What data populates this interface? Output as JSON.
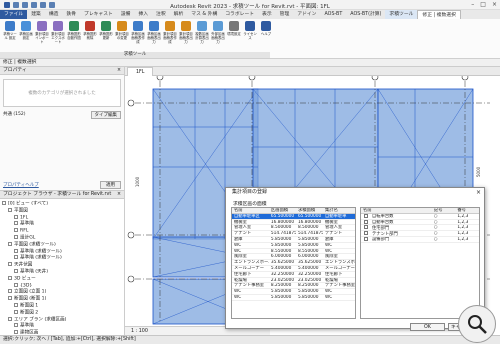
{
  "titlebar": {
    "title": "Autodesk Revit 2023 - 求積ツール for Revit.rvt - 平面図: 1FL"
  },
  "tabs": [
    "ファイル",
    "建築",
    "構造",
    "鉄骨",
    "プレキャスト",
    "設備",
    "挿入",
    "注釈",
    "解析",
    "マス & 外構",
    "コラボレート",
    "表示",
    "管理",
    "アドイン",
    "AOS-BT",
    "AOS-BT(計算)",
    "求積ツール",
    "修正 | 複数選択"
  ],
  "ribbon": {
    "buttons": [
      {
        "label": "求積ツール 設定",
        "color": "#3d7cc9"
      },
      {
        "label": "求積区画 設定",
        "color": "#4a90d9"
      },
      {
        "label": "集計項目 インポート",
        "color": "#8a6fc0"
      },
      {
        "label": "集計項目 エクスポート",
        "color": "#8a6fc0"
      },
      {
        "label": "求積図形 自動作図",
        "color": "#2e8b57"
      },
      {
        "label": "求積図形 削除",
        "color": "#c0392b"
      },
      {
        "label": "求積図形 更新",
        "color": "#2e8b57"
      },
      {
        "label": "集計項目 の変更",
        "color": "#d68a1b"
      },
      {
        "label": "求積区画 面積表作成",
        "color": "#3d7cc9"
      },
      {
        "label": "求積区画 面積表出力",
        "color": "#3d7cc9"
      },
      {
        "label": "集計項目 面積表作成",
        "color": "#d68a1b"
      },
      {
        "label": "集計項目 面積表出力",
        "color": "#d68a1b"
      },
      {
        "label": "複数区画 計算表出力",
        "color": "#5b9bd5"
      },
      {
        "label": "外部区画 面積表出力",
        "color": "#5b9bd5"
      },
      {
        "label": "環境設定",
        "color": "#777777"
      },
      {
        "label": "ライセンス",
        "color": "#2f5aa0"
      },
      {
        "label": "ヘルプ",
        "color": "#2f5aa0"
      }
    ],
    "panel_label": "求積ツール"
  },
  "optionsbar": {
    "text": "修正 | 複数選択"
  },
  "properties": {
    "title": "プロパティ",
    "type_hint": "複数のカテゴリが選択されました",
    "filter_value": "共通 (152)",
    "edit_type": "タイプ編集",
    "help_link": "プロパティヘルプ",
    "apply": "適用"
  },
  "browser": {
    "title": "プロジェクト ブラウザ - 求積ツール for Revit.rvt",
    "tree": [
      {
        "label": "[0] ビュー (すべて)",
        "level": 0
      },
      {
        "label": "平面図",
        "level": 1
      },
      {
        "label": "1FL",
        "level": 2
      },
      {
        "label": "基準階",
        "level": 2
      },
      {
        "label": "RFL",
        "level": 2
      },
      {
        "label": "設計GL",
        "level": 2
      },
      {
        "label": "平面図 (求積ツール)",
        "level": 1
      },
      {
        "label": "基準階 (求積ツール)",
        "level": 2
      },
      {
        "label": "基準階 (求積ツール)",
        "level": 2
      },
      {
        "label": "天井伏図",
        "level": 1
      },
      {
        "label": "基準階 (天井)",
        "level": 2
      },
      {
        "label": "3D ビュー",
        "level": 1
      },
      {
        "label": "{3D}",
        "level": 2
      },
      {
        "label": "立面図 (立面 1)",
        "level": 1
      },
      {
        "label": "断面図 (断面 1)",
        "level": 1
      },
      {
        "label": "断面図 1",
        "level": 2
      },
      {
        "label": "断面図 2",
        "level": 2
      },
      {
        "label": "エリア プラン (求積区画)",
        "level": 1
      },
      {
        "label": "基準階",
        "level": 2
      },
      {
        "label": "建物区画",
        "level": 2
      }
    ]
  },
  "view": {
    "tab_label": "1FL",
    "scale": "1 : 100",
    "dim_left": "1000",
    "dim_top": "5000"
  },
  "status": {
    "text": "選択:クリック; 次へ / [Tab], 追加:+[Ctrl], 選択解除:+[Shift]"
  },
  "dialog": {
    "title": "集計項目の登録",
    "label": "求積区画の面積",
    "left_headers": [
      "名前",
      "区画面積",
      "求積面積",
      "集計名"
    ],
    "left_rows": [
      [
        "自動車駐車区",
        "65.500000",
        "65.500000",
        "自動車駐車"
      ],
      [
        "機械室",
        "16.800000",
        "16.800000",
        "機械室"
      ],
      [
        "管理人室",
        "8.500000",
        "8.500000",
        "管理人室"
      ],
      [
        "テナント",
        "514.741875",
        "514.741875",
        "テナント"
      ],
      [
        "倉庫",
        "5.850000",
        "5.850000",
        "倉庫"
      ],
      [
        "WC",
        "5.850000",
        "5.850000",
        "WC"
      ],
      [
        "WC",
        "8.550000",
        "8.550000",
        "WC"
      ],
      [
        "風除室",
        "6.000000",
        "6.000000",
        "風除室"
      ],
      [
        "エントランスホール",
        "35.625000",
        "35.625000",
        "エントランスホール"
      ],
      [
        "メールコーナー",
        "5.400000",
        "5.400000",
        "メールコーナー"
      ],
      [
        "住宅廊下",
        "32.250000",
        "32.250000",
        "住宅廊下"
      ],
      [
        "乾燥場",
        "23.025000",
        "23.025000",
        "乾燥場"
      ],
      [
        "テナント事務室",
        "8.250000",
        "8.250000",
        "テナント事務室"
      ],
      [
        "WC",
        "5.850000",
        "5.850000",
        "WC"
      ],
      [
        "WC",
        "5.850000",
        "5.850000",
        "WC"
      ]
    ],
    "right_headers": [
      "名前",
      "記号",
      "番号"
    ],
    "right_rows": [
      [
        "自転車台数",
        "○",
        "1,2,3"
      ],
      [
        "自動車台数",
        "○",
        "1,2,3"
      ],
      [
        "住宅部門",
        "○",
        "1,2,3"
      ],
      [
        "テナント部門",
        "○",
        "1,2,3"
      ],
      [
        "設備部門",
        "○",
        "1,2,3"
      ]
    ],
    "ok": "OK",
    "cancel": "キャンセル"
  },
  "colors": {
    "selection_fill": "#7ea6de",
    "selection_stroke": "#1a52c9",
    "accent": "#2f5aa0"
  }
}
